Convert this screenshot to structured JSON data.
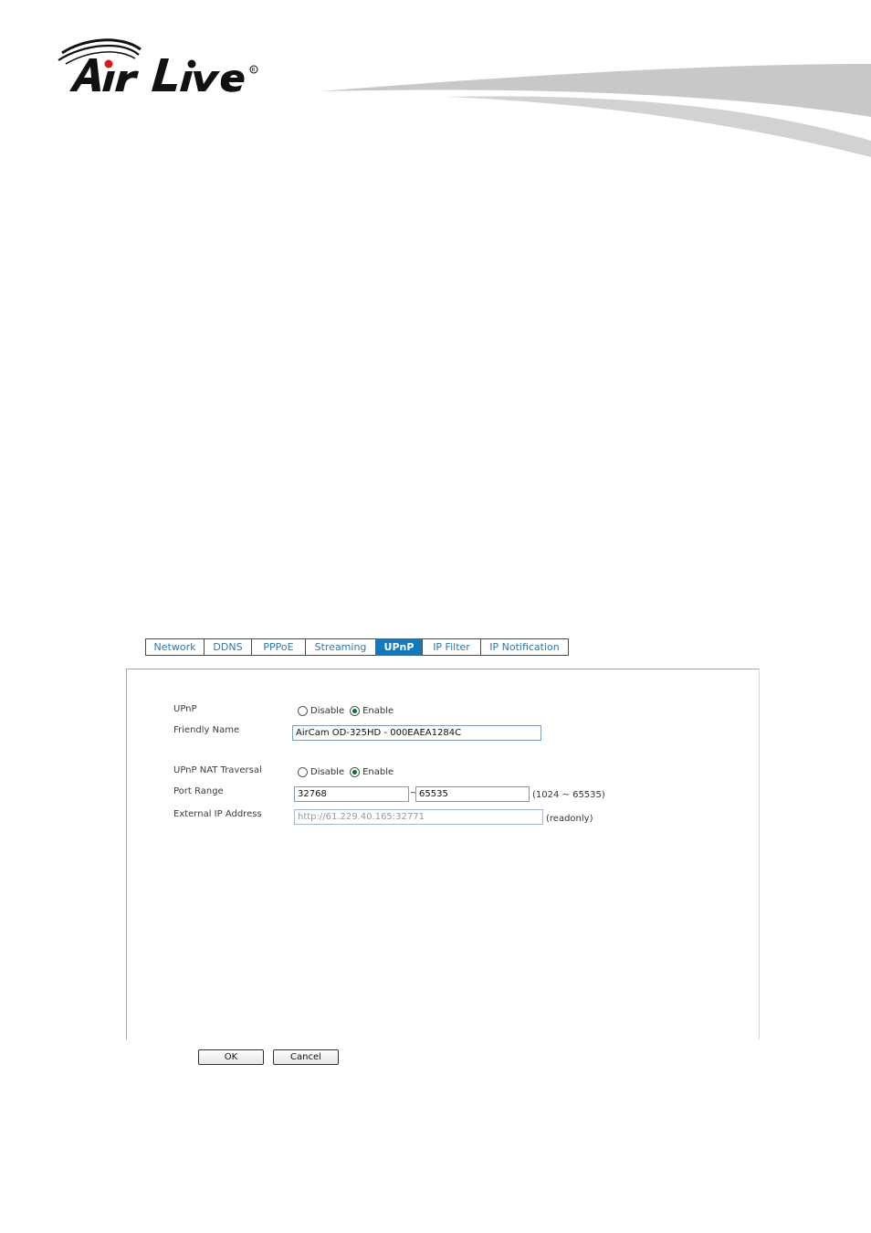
{
  "brand": {
    "logo_text": "Air Live",
    "registered": "®"
  },
  "tabs": [
    {
      "label": "Network"
    },
    {
      "label": "DDNS"
    },
    {
      "label": "PPPoE"
    },
    {
      "label": "Streaming"
    },
    {
      "label": "UPnP",
      "active": true
    },
    {
      "label": "IP Filter"
    },
    {
      "label": "IP Notification"
    }
  ],
  "form": {
    "upnp": {
      "label": "UPnP",
      "options": [
        "Disable",
        "Enable"
      ],
      "selected": "Enable"
    },
    "friendly_name": {
      "label": "Friendly Name",
      "value": "AirCam OD-325HD - 000EAEA1284C"
    },
    "nat_traversal": {
      "label": "UPnP NAT Traversal",
      "options": [
        "Disable",
        "Enable"
      ],
      "selected": "Enable"
    },
    "port_range": {
      "label": "Port Range",
      "from": "32768",
      "separator": "~",
      "to": "65535",
      "hint": "(1024 ~ 65535)"
    },
    "external_ip": {
      "label": "External IP Address",
      "value": "http://61.229.40.165:32771",
      "hint": "(readonly)"
    }
  },
  "buttons": {
    "ok": "OK",
    "cancel": "Cancel"
  },
  "colors": {
    "accent": "#1179be",
    "tab_text": "#2a78b4",
    "brand_red": "#d7191f"
  }
}
